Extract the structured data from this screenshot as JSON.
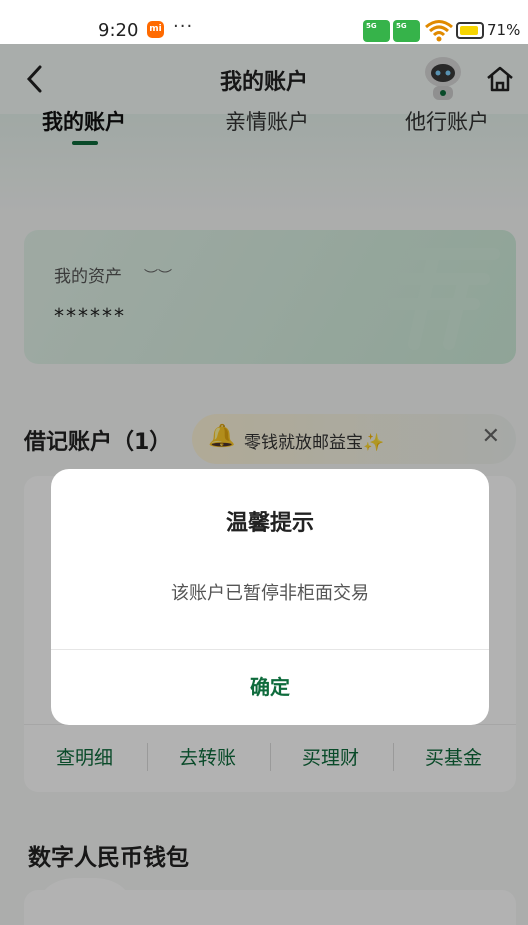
{
  "status_bar": {
    "time": "9:20",
    "more": "···",
    "battery": "71%",
    "signal_badge": "5G"
  },
  "header": {
    "title": "我的账户"
  },
  "tabs": [
    {
      "label": "我的账户",
      "active": true
    },
    {
      "label": "亲情账户",
      "active": false
    },
    {
      "label": "他行账户",
      "active": false
    }
  ],
  "assets": {
    "label": "我的资产",
    "masked_value": "******"
  },
  "debit": {
    "section_title": "借记账户（1）",
    "promo_text": "零钱就放邮益宝✨",
    "actions": [
      "查明细",
      "去转账",
      "买理财",
      "买基金"
    ]
  },
  "wallet": {
    "section_title": "数字人民币钱包"
  },
  "dialog": {
    "title": "温馨提示",
    "message": "该账户已暂停非柜面交易",
    "confirm_label": "确定"
  },
  "colors": {
    "brand_green": "#0e6b3c",
    "signal_green": "#36b34a",
    "battery_yellow": "#f7d500"
  }
}
